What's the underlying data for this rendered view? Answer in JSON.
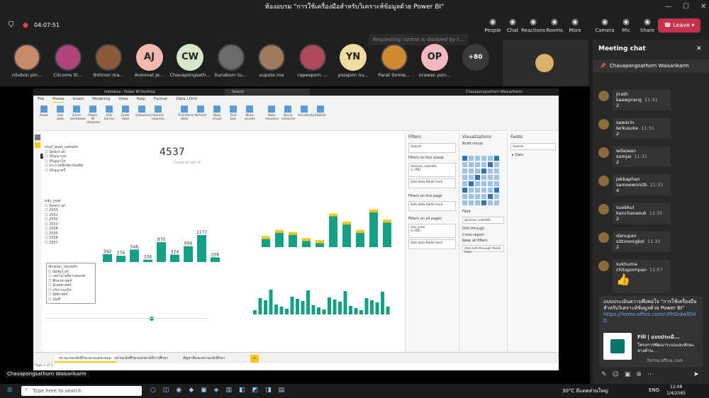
{
  "window": {
    "title": "ห้องอบรม \"การใช้เครื่องมือสำหรับวิเคราะห์ข้อมูลด้วย Power BI\""
  },
  "meeting": {
    "timer": "04:07:51",
    "control_msg": "Requesting control is disabled by t...",
    "buttons": [
      {
        "label": "People",
        "icon": "people-icon"
      },
      {
        "label": "Chat",
        "icon": "chat-icon"
      },
      {
        "label": "Reactions",
        "icon": "reactions-icon"
      },
      {
        "label": "Rooms",
        "icon": "rooms-icon"
      },
      {
        "label": "More",
        "icon": "more-icon"
      },
      {
        "label": "Camera",
        "icon": "camera-icon"
      },
      {
        "label": "Mic",
        "icon": "mic-icon"
      },
      {
        "label": "Share",
        "icon": "share-icon"
      }
    ],
    "leave_label": "Leave"
  },
  "participants": [
    {
      "name": "nilubon pin...",
      "initials": "",
      "color": "#c98a6b"
    },
    {
      "name": "Citcoms Itl...",
      "initials": "",
      "color": "#b0437a"
    },
    {
      "name": "thitinon ma...",
      "initials": "",
      "color": "#8a5a3a"
    },
    {
      "name": "Anonnat Je...",
      "initials": "AJ",
      "color": "#f4b8b0"
    },
    {
      "name": "Chavapongsath...",
      "initials": "CW",
      "color": "#d6e8c8"
    },
    {
      "name": "kunakorn tu...",
      "initials": "",
      "color": "#6b6b6b"
    },
    {
      "name": "supote.ma",
      "initials": "",
      "color": "#a07a5a"
    },
    {
      "name": "rapeeporn ...",
      "initials": "",
      "color": "#b04a5a"
    },
    {
      "name": "yosspon nu...",
      "initials": "YN",
      "color": "#f0dca0"
    },
    {
      "name": "Parat Somw...",
      "initials": "",
      "color": "#d08a30"
    },
    {
      "name": "orawan pon...",
      "initials": "OP",
      "color": "#f4b8c0"
    },
    {
      "name": "",
      "initials": "+80",
      "color": "#3a3a3a"
    }
  ],
  "powerbi": {
    "title": "stdstatus - Power BI Desktop",
    "search": "Search",
    "user": "Chavapongsathorn Waisarikarm",
    "ribbon_tabs": [
      "File",
      "Home",
      "Insert",
      "Modeling",
      "View",
      "Help",
      "Format",
      "Data / Drill"
    ],
    "ribbon_buttons": [
      "Paste",
      "Get data",
      "Excel workbook",
      "Power BI datasets",
      "SQL Server",
      "Enter data",
      "Dataverse",
      "Recent sources",
      "Transform data",
      "Refresh",
      "New visual",
      "Text box",
      "More visuals",
      "New measure",
      "Quick measure",
      "Sensitivity",
      "Publish"
    ],
    "kpi": {
      "value": "4537",
      "label": "Count of std_id"
    },
    "slicer1": {
      "title": "stud_level_nameth",
      "items": [
        "Select all",
        "ปริญญาเอก",
        "ปริญญาโท",
        "ประกาศนียบัตรบัณฑิต",
        "ปริญญาตรี"
      ]
    },
    "slicer2": {
      "title": "edu_year",
      "items": [
        "Select all",
        "2550",
        "2551",
        "2552",
        "2553",
        "2554",
        "2555",
        "2556",
        "2557"
      ]
    },
    "slicer3": {
      "title": "division_nameth",
      "items": [
        "Select all",
        "เทคโนโลยีสารสนเทศ",
        "ศึกษาศาสตร์",
        "นิเทศศาสตร์",
        "บริหารธุรกิจ",
        "นิติศาสตร์",
        "บัญชี"
      ]
    },
    "tooltip": "Data",
    "filters": {
      "title": "Filters",
      "search": "Search",
      "on_visual": "Filters on this visual",
      "f1": "division_nameth",
      "f1v": "is (All)",
      "add": "Add data fields here",
      "on_page": "Filters on this page",
      "on_all": "Filters on all pages",
      "f2": "edu_year",
      "f2v": "is (All)"
    },
    "viz": {
      "title": "Visualizations",
      "build": "Build visual",
      "field": "Field",
      "fieldval": "division_nameth",
      "drill": "Drill through",
      "cross": "Cross-report",
      "keep": "Keep all filters",
      "adddrill": "Add drill-through fields here"
    },
    "fields": {
      "title": "Fields",
      "search": "Search",
      "item": "Data"
    },
    "tabs": [
      "สถานะของนักศึกษาตามแต่ละคณะ",
      "สถานะนักศึกษาแยกตามปีการศึกษา",
      "สัญชาติและสถานะนักศึกษา"
    ],
    "page_label": "Page 1 of 3"
  },
  "chart_main": {
    "values": [
      342,
      276,
      546,
      104,
      870,
      324,
      694,
      1177,
      206
    ]
  },
  "presenter": "Chavapongsathorn Waisarikarm",
  "chat": {
    "title": "Meeting chat",
    "pinned": "Chavapongsathorn Waisarikarm",
    "messages": [
      {
        "name": "jirath kaewprang",
        "time": "11:31",
        "text": "2"
      },
      {
        "name": "sawarin lerkusuke",
        "time": "11:31",
        "text": "2"
      },
      {
        "name": "wilaiwan somjai",
        "time": "11:31",
        "text": "2"
      },
      {
        "name": "jakkaphan samoewontib",
        "time": "11:31",
        "text": "4"
      },
      {
        "name": "suebkul kanchanasuk",
        "time": "11:31",
        "text": "2"
      },
      {
        "name": "danupan sittimongkol",
        "time": "11:31",
        "text": "2"
      },
      {
        "name": "sukhuma chitapornpan",
        "time": "11:57",
        "text": "👍"
      }
    ],
    "card_text": "แบบประเมินความพึงพอใจ \"การใช้เครื่องมือสำหรับวิเคราะห์ข้อมูลด้วย Power BI\"",
    "card_link": "https://forms.office.com/r/PhSrdwfDHD",
    "card_title": "Fill | แบบประเมิ...",
    "card_sub": "โครงการพัฒนาระบบและทักษะทางด้าน...",
    "card_domain": "forms.office.com"
  },
  "taskbar": {
    "search": "Type here to search",
    "weather": "30°C มีแดดส่วนใหญ่",
    "lang": "ENG",
    "time": "12:06",
    "date": "1/4/2565"
  }
}
